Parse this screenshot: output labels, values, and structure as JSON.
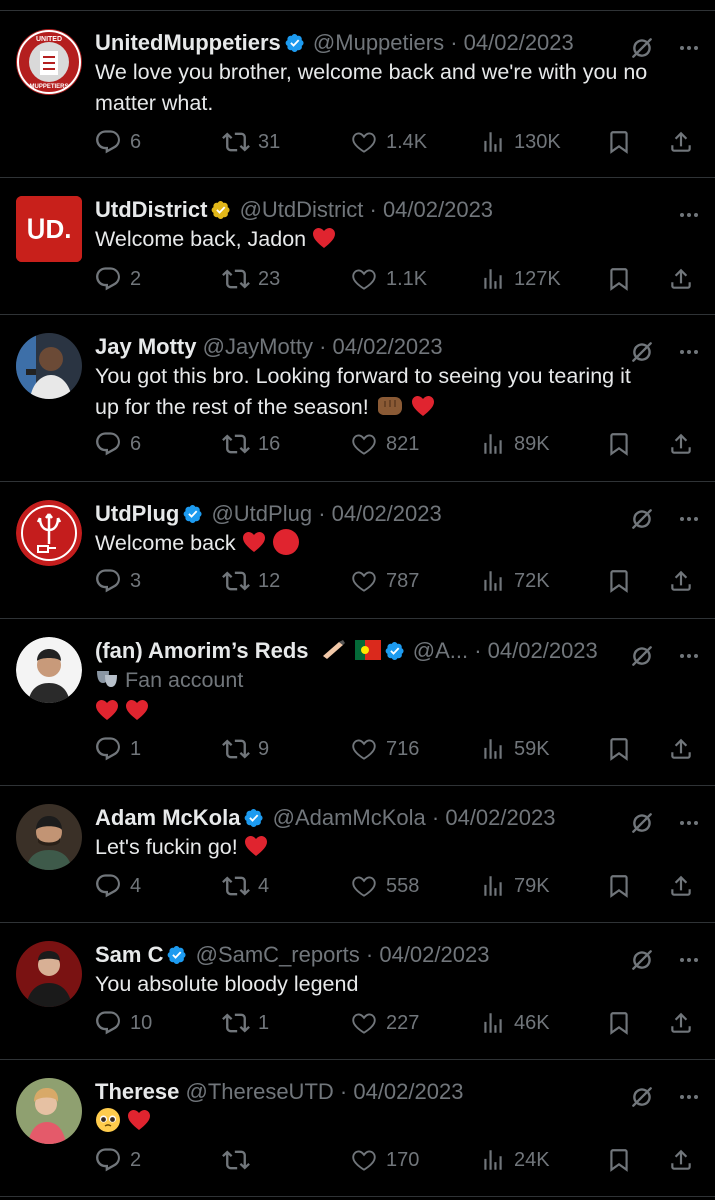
{
  "colors": {
    "background": "#000000",
    "text": "#e7e9ea",
    "muted": "#71767b",
    "verified_blue": "#1d9bf0",
    "verified_gold": "#e2b719",
    "divider": "#2f3336"
  },
  "icons": {
    "reply": "reply-icon",
    "retweet": "retweet-icon",
    "like": "heart-icon",
    "views": "views-icon",
    "bookmark": "bookmark-icon",
    "share": "share-icon",
    "grok": "grok-icon",
    "more": "more-icon"
  },
  "tweets": [
    {
      "name": "UnitedMuppetiers",
      "handle": "@Muppetiers",
      "date": "· 04/02/2023",
      "text_line1": "We love you brother, welcome back and we're with you no",
      "text_line2": "matter what.",
      "replies": "6",
      "retweets": "31",
      "likes": "1.4K",
      "views": "130K",
      "avatar_text_top": "UNITED",
      "avatar_text_bottom": "MUPPETIERS"
    },
    {
      "name": "UtdDistrict",
      "handle": "@UtdDistrict",
      "date": "· 04/02/2023",
      "text": "Welcome back, Jadon",
      "replies": "2",
      "retweets": "23",
      "likes": "1.1K",
      "views": "127K",
      "avatar_text": "ᑌD."
    },
    {
      "name": "Jay Motty",
      "handle": "@JayMotty",
      "date": "· 04/02/2023",
      "text_line1": "You got this bro. Looking forward to seeing you tearing it",
      "text_line2": "up for the rest of the season!",
      "replies": "6",
      "retweets": "16",
      "likes": "821",
      "views": "89K"
    },
    {
      "name": "UtdPlug",
      "handle": "@UtdPlug",
      "date": "· 04/02/2023",
      "text": "Welcome back",
      "replies": "3",
      "retweets": "12",
      "likes": "787",
      "views": "72K"
    },
    {
      "name": "(fan) Amorim’s Reds",
      "handle": "@A...",
      "date": "· 04/02/2023",
      "bio": "Fan account",
      "replies": "1",
      "retweets": "9",
      "likes": "716",
      "views": "59K"
    },
    {
      "name": "Adam McKola",
      "handle": "@AdamMcKola",
      "date": "· 04/02/2023",
      "text": "Let's fuckin go!",
      "replies": "4",
      "retweets": "4",
      "likes": "558",
      "views": "79K"
    },
    {
      "name": "Sam C",
      "handle": "@SamC_reports",
      "date": "· 04/02/2023",
      "text": "You absolute bloody legend",
      "replies": "10",
      "retweets": "1",
      "likes": "227",
      "views": "46K"
    },
    {
      "name": "Therese",
      "handle": "@ThereseUTD",
      "date": "· 04/02/2023",
      "replies": "2",
      "retweets": "",
      "likes": "170",
      "views": "24K"
    }
  ]
}
